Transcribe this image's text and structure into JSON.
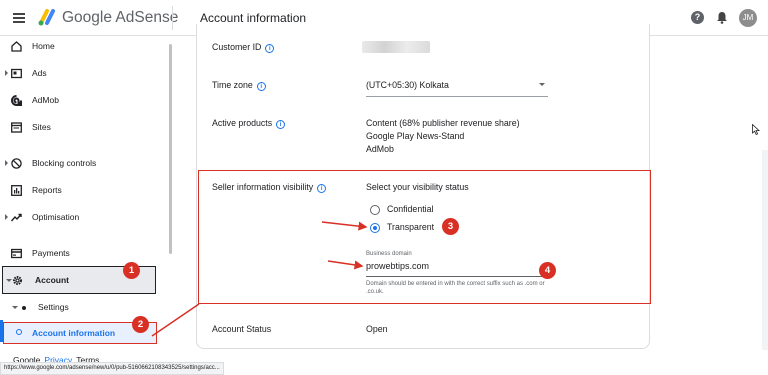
{
  "header": {
    "brand": "Google AdSense",
    "title": "Account information",
    "avatar_text": "JM"
  },
  "sidebar": {
    "items": [
      {
        "label": "Home",
        "icon": "home-icon"
      },
      {
        "label": "Ads",
        "icon": "ads-icon"
      },
      {
        "label": "AdMob",
        "icon": "admob-icon"
      },
      {
        "label": "Sites",
        "icon": "sites-icon"
      },
      {
        "label": "Blocking controls",
        "icon": "block-icon"
      },
      {
        "label": "Reports",
        "icon": "reports-icon"
      },
      {
        "label": "Optimisation",
        "icon": "trend-icon"
      },
      {
        "label": "Payments",
        "icon": "payments-icon"
      },
      {
        "label": "Account",
        "icon": "gear-icon"
      },
      {
        "label": "Settings",
        "icon": "dot-icon"
      },
      {
        "label": "Account information",
        "icon": "ring-icon"
      }
    ],
    "footer": {
      "google": "Google",
      "privacy": "Privacy",
      "terms": "Terms"
    }
  },
  "status_url": "https://www.google.com/adsense/new/u/0/pub-5160662108343525/settings/acc...",
  "main": {
    "customer_id_label": "Customer ID",
    "time_zone_label": "Time zone",
    "time_zone_value": "(UTC+05:30) Kolkata",
    "active_products_label": "Active products",
    "active_products": [
      "Content (68% publisher revenue share)",
      "Google Play News-Stand",
      "AdMob"
    ],
    "seller_label": "Seller information visibility",
    "visibility_prompt": "Select your visibility status",
    "options": {
      "confidential": "Confidential",
      "transparent": "Transparent"
    },
    "selected_option": "Transparent",
    "business_domain_caption": "Business domain",
    "business_domain_value": "prowebtips.com",
    "business_domain_hint": "Domain should be entered in with the correct suffix such as .com or .co.uk.",
    "account_status_label": "Account Status",
    "account_status_value": "Open"
  },
  "annotations": {
    "badge1": "1",
    "badge2": "2",
    "badge3": "3",
    "badge4": "4"
  },
  "colors": {
    "accent": "#1a73e8",
    "annotation_red": "#d93025",
    "active_bg": "#e8f0fe"
  }
}
